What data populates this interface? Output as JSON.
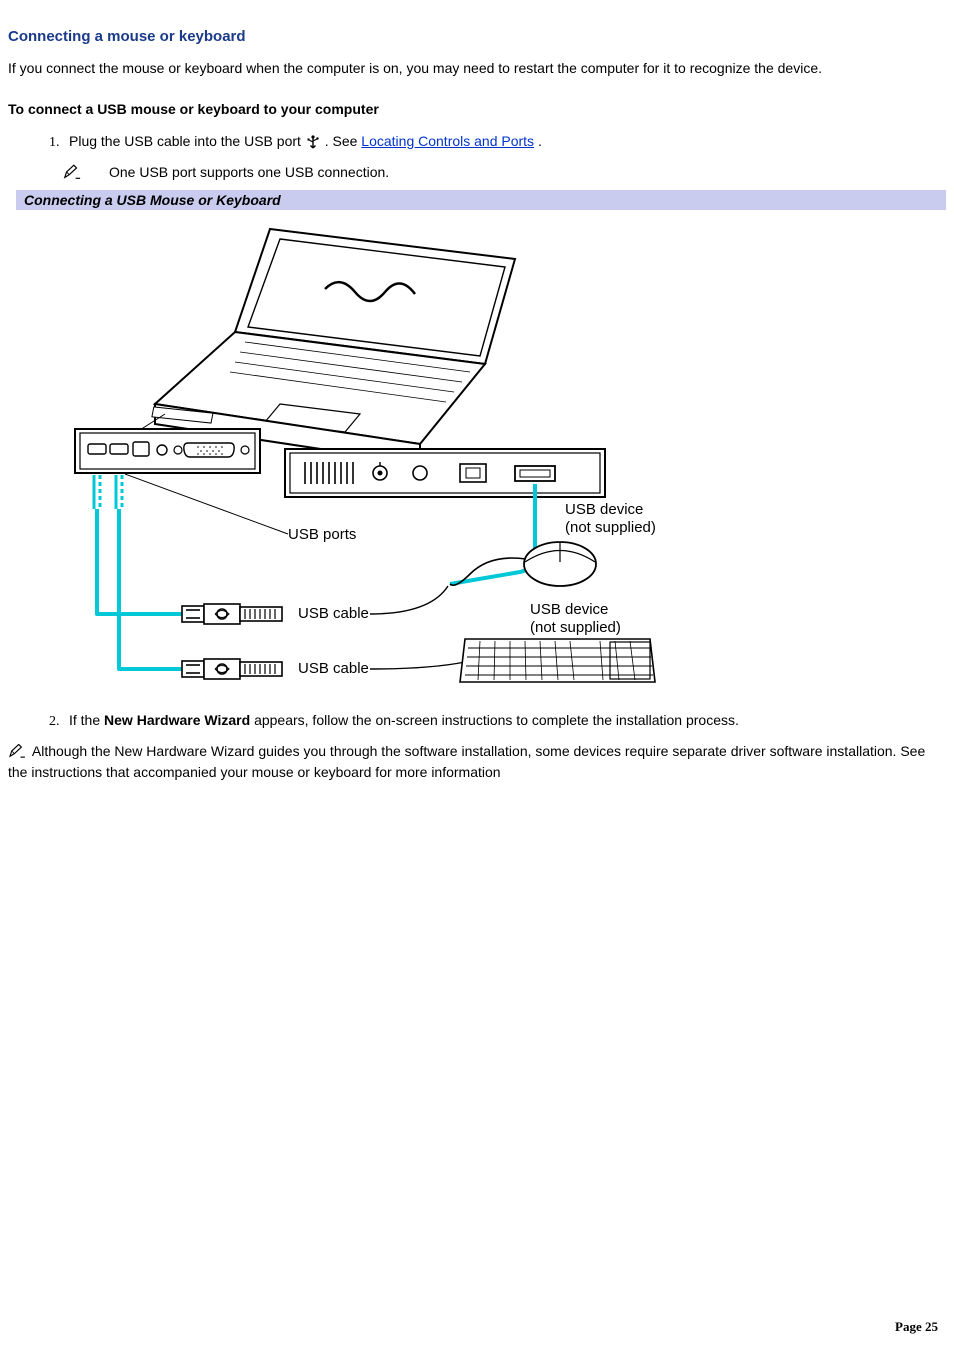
{
  "section_title": "Connecting a mouse or keyboard",
  "intro": "If you connect the mouse or keyboard when the computer is on, you may need to restart the computer for it to recognize the device.",
  "subheading": "To connect a USB mouse or keyboard to your computer",
  "step1_prefix": "Plug the USB cable into the USB port ",
  "step1_see": ". See ",
  "step1_link": "Locating Controls and Ports",
  "step1_suffix": ".",
  "note1": "One USB port supports one USB connection.",
  "figure_caption": "Connecting a USB Mouse or Keyboard",
  "diagram": {
    "usb_ports": "USB ports",
    "usb_cable": "USB cable",
    "usb_device": "USB device",
    "not_supplied": "(not supplied)"
  },
  "step2_prefix": "If the ",
  "step2_bold": "New Hardware Wizard",
  "step2_suffix": " appears, follow the on-screen instructions to complete the installation process.",
  "note2": " Although the New Hardware Wizard guides you through the software installation, some devices require separate driver software installation. See the instructions that accompanied your mouse or keyboard for more information",
  "page_number": "Page 25"
}
